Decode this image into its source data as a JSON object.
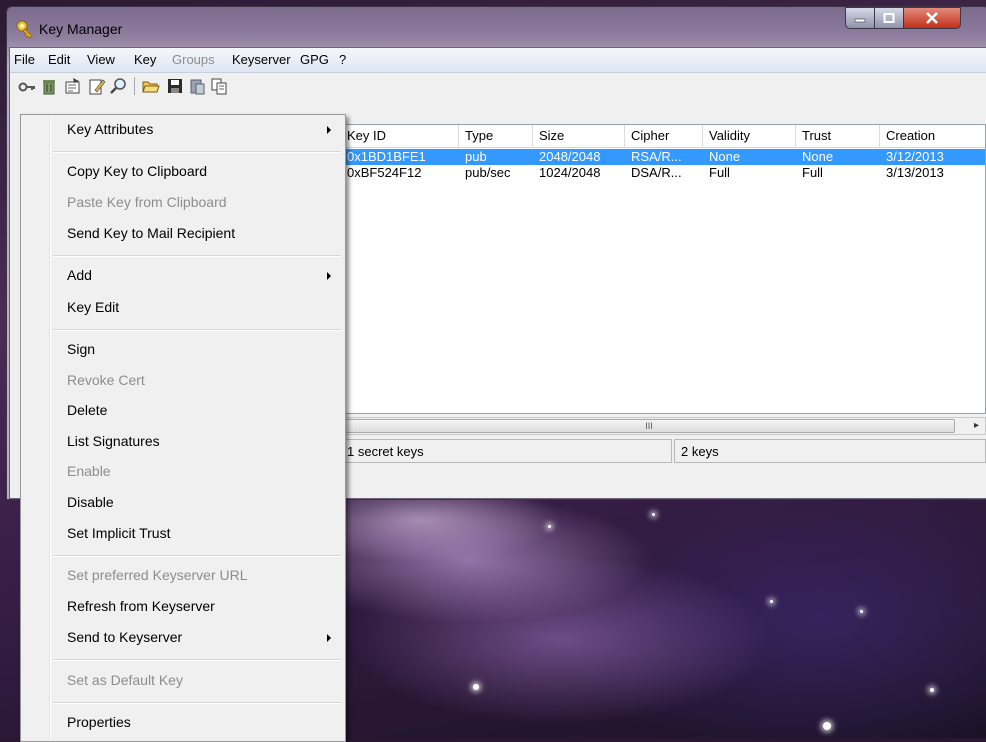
{
  "window": {
    "title": "Key Manager"
  },
  "menubar": [
    {
      "label": "File",
      "disabled": false
    },
    {
      "label": "Edit",
      "disabled": false
    },
    {
      "label": "View",
      "disabled": false
    },
    {
      "label": "Key",
      "disabled": false
    },
    {
      "label": "Groups",
      "disabled": true
    },
    {
      "label": "Keyserver",
      "disabled": false
    },
    {
      "label": "GPG",
      "disabled": false
    },
    {
      "label": "?",
      "disabled": false
    }
  ],
  "toolbar": [
    "key-icon",
    "trash-icon",
    "properties-icon",
    "edit-icon",
    "search-icon",
    "open-folder-icon",
    "save-icon",
    "paste-icon",
    "copy-icon"
  ],
  "list": {
    "columns": [
      "Key ID",
      "Type",
      "Size",
      "Cipher",
      "Validity",
      "Trust",
      "Creation"
    ],
    "rows": [
      [
        "0x1BD1BFE1",
        "pub",
        "2048/2048",
        "RSA/R...",
        "None",
        "None",
        "3/12/2013"
      ],
      [
        "0xBF524F12",
        "pub/sec",
        "1024/2048",
        "DSA/R...",
        "Full",
        "Full",
        "3/13/2013"
      ]
    ],
    "selected_row": 0
  },
  "scrollbar": {
    "grip": "III"
  },
  "status": {
    "secret_keys": "1 secret keys",
    "keys": "2 keys"
  },
  "context_menu": {
    "items": [
      {
        "label": "Key Attributes",
        "disabled": false,
        "submenu": true
      },
      {
        "label": "Copy Key to Clipboard",
        "disabled": false,
        "submenu": false
      },
      {
        "label": "Paste Key from Clipboard",
        "disabled": true,
        "submenu": false
      },
      {
        "label": "Send Key to Mail Recipient",
        "disabled": false,
        "submenu": false
      },
      {
        "label": "Add",
        "disabled": false,
        "submenu": true
      },
      {
        "label": "Key Edit",
        "disabled": false,
        "submenu": false
      },
      {
        "label": "Sign",
        "disabled": false,
        "submenu": false
      },
      {
        "label": "Revoke Cert",
        "disabled": true,
        "submenu": false
      },
      {
        "label": "Delete",
        "disabled": false,
        "submenu": false
      },
      {
        "label": "List Signatures",
        "disabled": false,
        "submenu": false
      },
      {
        "label": "Enable",
        "disabled": true,
        "submenu": false
      },
      {
        "label": "Disable",
        "disabled": false,
        "submenu": false
      },
      {
        "label": "Set Implicit Trust",
        "disabled": false,
        "submenu": false
      },
      {
        "label": "Set preferred Keyserver URL",
        "disabled": true,
        "submenu": false
      },
      {
        "label": "Refresh from Keyserver",
        "disabled": false,
        "submenu": false
      },
      {
        "label": "Send to Keyserver",
        "disabled": false,
        "submenu": true
      },
      {
        "label": "Set as Default Key",
        "disabled": true,
        "submenu": false
      },
      {
        "label": "Properties",
        "disabled": false,
        "submenu": false
      }
    ]
  },
  "colors": {
    "selection": "#3399ff",
    "desktop": "#2a1630"
  }
}
